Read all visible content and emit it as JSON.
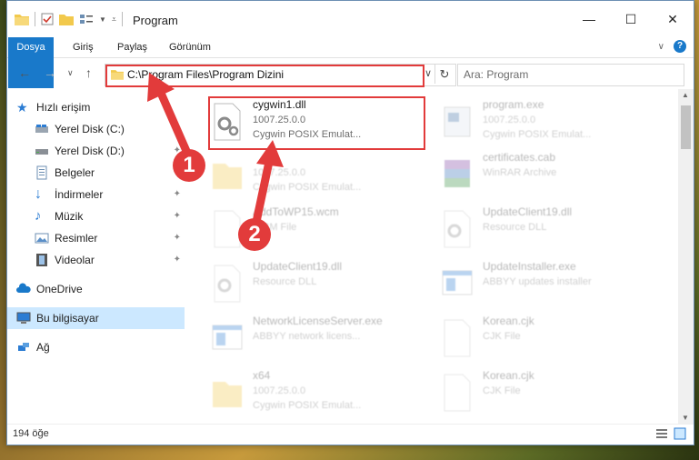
{
  "window": {
    "title": "Program"
  },
  "ribbon": {
    "tabs": [
      "Dosya",
      "Giriş",
      "Paylaş",
      "Görünüm"
    ]
  },
  "address": {
    "path": "C:\\Program Files\\Program Dizini"
  },
  "search": {
    "placeholder": "Ara: Program"
  },
  "sidebar": {
    "items": [
      {
        "label": "Hızlı erişim"
      },
      {
        "label": "Yerel Disk (C:)"
      },
      {
        "label": "Yerel Disk (D:)"
      },
      {
        "label": "Belgeler"
      },
      {
        "label": "İndirmeler"
      },
      {
        "label": "Müzik"
      },
      {
        "label": "Resimler"
      },
      {
        "label": "Videolar"
      },
      {
        "label": "OneDrive"
      },
      {
        "label": "Bu bilgisayar"
      },
      {
        "label": "Ağ"
      }
    ]
  },
  "files": [
    {
      "name": "cygwin1.dll",
      "version": "1007.25.0.0",
      "desc": "Cygwin POSIX Emulat..."
    },
    {
      "name": "program.exe",
      "version": "1007.25.0.0",
      "desc": "Cygwin POSIX Emulat..."
    },
    {
      "name": "",
      "version": "1007.25.0.0",
      "desc": "Cygwin POSIX Emulat..."
    },
    {
      "name": "certificates.cab",
      "version": "WinRAR Archive",
      "desc": ""
    },
    {
      "name": "AddToWP15.wcm",
      "version": "WCM File",
      "desc": ""
    },
    {
      "name": "UpdateClient19.dll",
      "version": "Resource DLL",
      "desc": ""
    },
    {
      "name": "UpdateClient19.dll",
      "version": "Resource DLL",
      "desc": ""
    },
    {
      "name": "UpdateInstaller.exe",
      "version": "ABBYY updates installer",
      "desc": ""
    },
    {
      "name": "NetworkLicenseServer.exe",
      "version": "ABBYY network licens...",
      "desc": ""
    },
    {
      "name": "Korean.cjk",
      "version": "CJK File",
      "desc": ""
    },
    {
      "name": "x64",
      "version": "1007.25.0.0",
      "desc": "Cygwin POSIX Emulat..."
    },
    {
      "name": "Korean.cjk",
      "version": "CJK File",
      "desc": ""
    }
  ],
  "status": {
    "count": "194 öğe"
  },
  "annotations": {
    "step1": "1",
    "step2": "2"
  },
  "colors": {
    "accent": "#1979ca",
    "highlight": "#e23b3b"
  }
}
